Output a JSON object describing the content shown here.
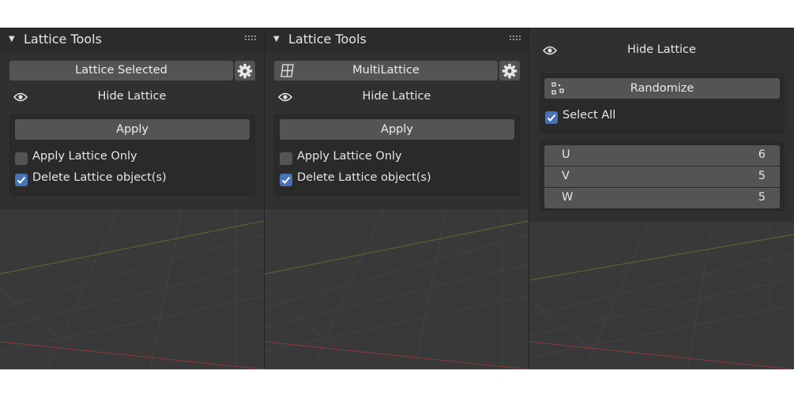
{
  "colors": {
    "viewport": "#393939",
    "panel": "#303030",
    "header": "#2b2b2b",
    "button": "#545454",
    "checkbox_on": "#4772b3",
    "grid_x_axis": "#8c3a3a",
    "grid_y_axis": "#5d6b2e"
  },
  "panels": [
    {
      "header": {
        "title": "Lattice Tools"
      },
      "mode_button": {
        "label": "Lattice Selected"
      },
      "hide_row": {
        "label": "Hide Lattice",
        "icon": "eye-icon"
      },
      "apply_button": {
        "label": "Apply"
      },
      "options": [
        {
          "label": "Apply Lattice Only",
          "checked": false
        },
        {
          "label": "Delete Lattice object(s)",
          "checked": true
        }
      ]
    },
    {
      "header": {
        "title": "Lattice Tools"
      },
      "mode_button": {
        "label": "MultiLattice",
        "icon": "grid-icon"
      },
      "hide_row": {
        "label": "Hide Lattice",
        "icon": "eye-icon"
      },
      "apply_button": {
        "label": "Apply"
      },
      "options": [
        {
          "label": "Apply Lattice Only",
          "checked": false
        },
        {
          "label": "Delete Lattice object(s)",
          "checked": true
        }
      ]
    },
    {
      "hide_row": {
        "label": "Hide Lattice",
        "icon": "eye-icon"
      },
      "randomize_button": {
        "label": "Randomize",
        "icon": "randomize-icon"
      },
      "select_all": {
        "label": "Select All",
        "checked": true
      },
      "resolution": [
        {
          "axis": "U",
          "value": "6"
        },
        {
          "axis": "V",
          "value": "5"
        },
        {
          "axis": "W",
          "value": "5"
        }
      ]
    }
  ]
}
